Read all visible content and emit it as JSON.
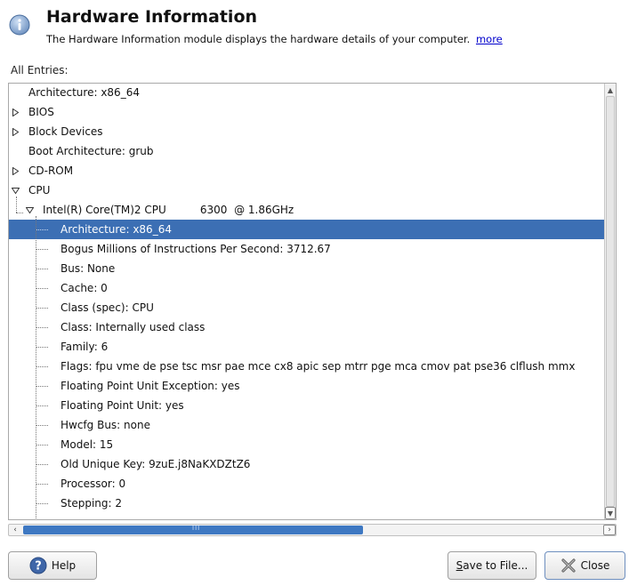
{
  "header": {
    "title": "Hardware Information",
    "description": "The Hardware Information module displays the hardware details of your computer.",
    "more_link": "more"
  },
  "entries_label": "All Entries:",
  "tree": [
    {
      "label": "Architecture: x86_64",
      "level": 0,
      "expander": "none"
    },
    {
      "label": "BIOS",
      "level": 0,
      "expander": "collapsed"
    },
    {
      "label": "Block Devices",
      "level": 0,
      "expander": "collapsed"
    },
    {
      "label": "Boot Architecture: grub",
      "level": 0,
      "expander": "none"
    },
    {
      "label": "CD-ROM",
      "level": 0,
      "expander": "collapsed"
    },
    {
      "label": "CPU",
      "level": 0,
      "expander": "expanded"
    },
    {
      "label": "Intel(R) Core(TM)2 CPU          6300  @ 1.86GHz",
      "level": 1,
      "expander": "expanded"
    },
    {
      "label": "Architecture: x86_64",
      "level": 2,
      "expander": "none",
      "selected": true
    },
    {
      "label": "Bogus Millions of Instructions Per Second: 3712.67",
      "level": 2,
      "expander": "none"
    },
    {
      "label": "Bus: None",
      "level": 2,
      "expander": "none"
    },
    {
      "label": "Cache: 0",
      "level": 2,
      "expander": "none"
    },
    {
      "label": "Class (spec): CPU",
      "level": 2,
      "expander": "none"
    },
    {
      "label": "Class: Internally used class",
      "level": 2,
      "expander": "none"
    },
    {
      "label": "Family: 6",
      "level": 2,
      "expander": "none"
    },
    {
      "label": "Flags: fpu vme de pse tsc msr pae mce cx8 apic sep mtrr pge mca cmov pat pse36 clflush mmx",
      "level": 2,
      "expander": "none"
    },
    {
      "label": "Floating Point Unit Exception: yes",
      "level": 2,
      "expander": "none"
    },
    {
      "label": "Floating Point Unit: yes",
      "level": 2,
      "expander": "none"
    },
    {
      "label": "Hwcfg Bus: none",
      "level": 2,
      "expander": "none"
    },
    {
      "label": "Model: 15",
      "level": 2,
      "expander": "none"
    },
    {
      "label": "Old Unique Key: 9zuE.j8NaKXDZtZ6",
      "level": 2,
      "expander": "none"
    },
    {
      "label": "Processor: 0",
      "level": 2,
      "expander": "none"
    },
    {
      "label": "Stepping: 2",
      "level": 2,
      "expander": "none"
    }
  ],
  "buttons": {
    "help": "Help",
    "save": "Save to File...",
    "close": "Close"
  },
  "colors": {
    "selection": "#3c6fb4",
    "link": "#0000cc",
    "info_icon": "#3a6fb0"
  }
}
